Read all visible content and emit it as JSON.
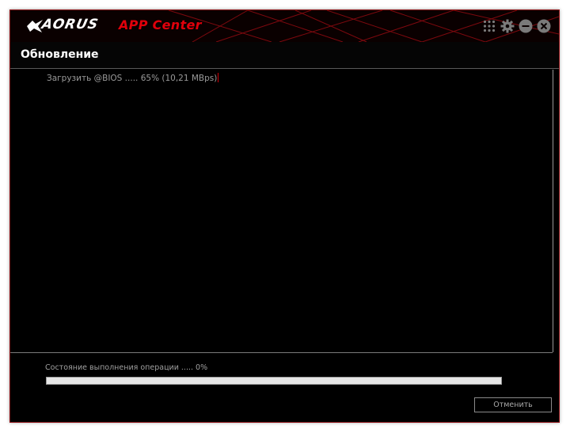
{
  "app": {
    "brand": "AORUS",
    "title": "APP Center"
  },
  "titlebar": {
    "icons": [
      "apps-grid-icon",
      "gear-icon",
      "minimize-icon",
      "close-icon"
    ]
  },
  "section": {
    "title": "Обновление"
  },
  "log": {
    "lines": [
      "Загрузить  @BIOS ..... 65% (10,21 MBps)"
    ]
  },
  "download": {
    "progress_percent": 65
  },
  "status": {
    "text": "Состояние выполнения операции ..... 0%",
    "progress_percent": 0
  },
  "buttons": {
    "cancel_label": "Отменить"
  },
  "colors": {
    "accent": "#e0000b",
    "background": "#000000",
    "text_muted": "#9a9a9a"
  }
}
